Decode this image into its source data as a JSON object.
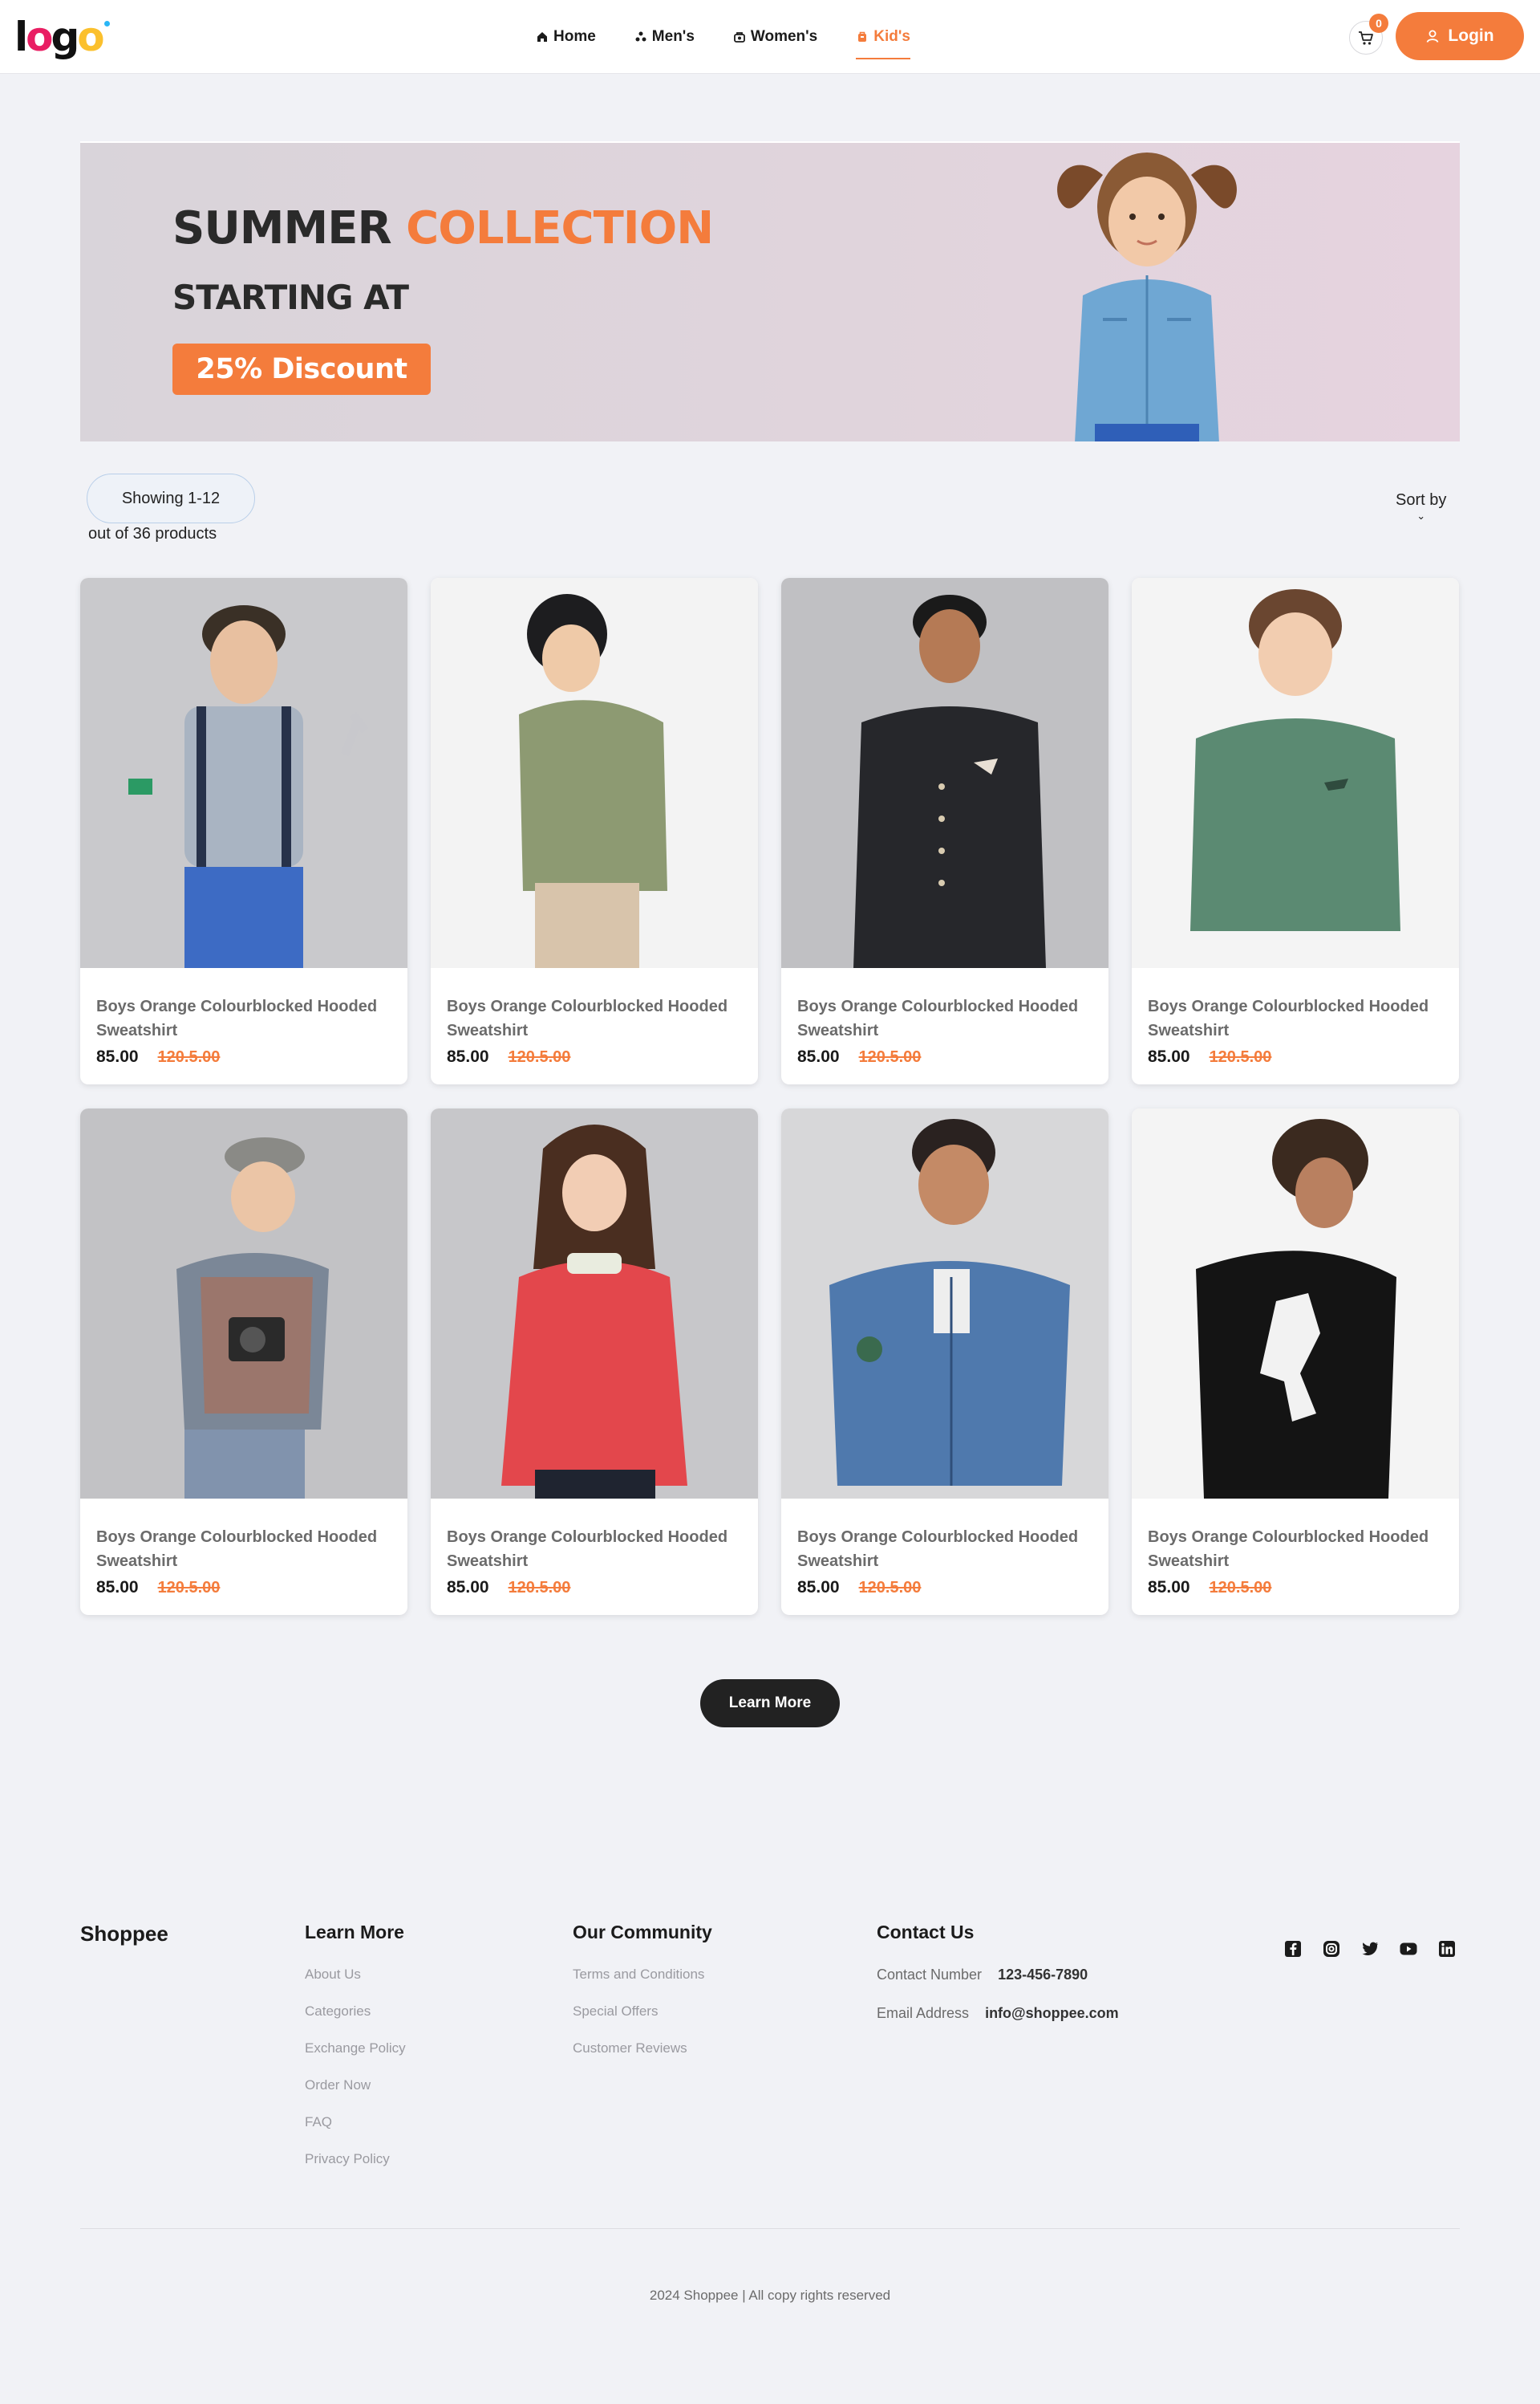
{
  "header": {
    "logo": "logo",
    "nav": [
      {
        "label": "Home",
        "icon": "home-icon"
      },
      {
        "label": "Men's",
        "icon": "men-icon"
      },
      {
        "label": "Women's",
        "icon": "women-icon"
      },
      {
        "label": "Kid's",
        "icon": "kids-icon",
        "active": true
      }
    ],
    "cart_count": "0",
    "login_label": "Login"
  },
  "banner": {
    "line1_a": "SUMMER",
    "line1_b": "COLLECTION",
    "line2": "STARTING AT",
    "cta": "25% Discount"
  },
  "toolbar": {
    "showing": "Showing 1-12",
    "out_of": "out of 36 products",
    "sort_label": "Sort by"
  },
  "products": [
    {
      "title": "Boys Orange Colourblocked Hooded Sweatshirt",
      "price": "85.00",
      "old_price": "120.5.00"
    },
    {
      "title": "Boys Orange Colourblocked Hooded Sweatshirt",
      "price": "85.00",
      "old_price": "120.5.00"
    },
    {
      "title": "Boys Orange Colourblocked Hooded Sweatshirt",
      "price": "85.00",
      "old_price": "120.5.00"
    },
    {
      "title": "Boys Orange Colourblocked Hooded Sweatshirt",
      "price": "85.00",
      "old_price": "120.5.00"
    },
    {
      "title": "Boys Orange Colourblocked Hooded Sweatshirt",
      "price": "85.00",
      "old_price": "120.5.00"
    },
    {
      "title": "Boys Orange Colourblocked Hooded Sweatshirt",
      "price": "85.00",
      "old_price": "120.5.00"
    },
    {
      "title": "Boys Orange Colourblocked Hooded Sweatshirt",
      "price": "85.00",
      "old_price": "120.5.00"
    },
    {
      "title": "Boys Orange Colourblocked Hooded Sweatshirt",
      "price": "85.00",
      "old_price": "120.5.00"
    }
  ],
  "learn_more_button": "Learn More",
  "footer": {
    "brand": "Shoppee",
    "learn_more": {
      "heading": "Learn More",
      "links": [
        "About Us",
        "Categories",
        "Exchange Policy",
        "Order Now",
        "FAQ",
        "Privacy Policy"
      ]
    },
    "community": {
      "heading": "Our Community",
      "links": [
        "Terms and Conditions",
        "Special Offers",
        "Customer Reviews"
      ]
    },
    "contact": {
      "heading": "Contact Us",
      "phone_label": "Contact Number",
      "phone": "123-456-7890",
      "email_label": "Email Address",
      "email": "info@shoppee.com"
    },
    "socials": [
      "facebook-icon",
      "instagram-icon",
      "twitter-icon",
      "youtube-icon",
      "linkedin-icon"
    ],
    "copyright": "2024 Shoppee | All copy rights reserved"
  },
  "colors": {
    "accent": "#f47c3c",
    "background": "#f1f2f6",
    "dark_button": "#222222"
  }
}
